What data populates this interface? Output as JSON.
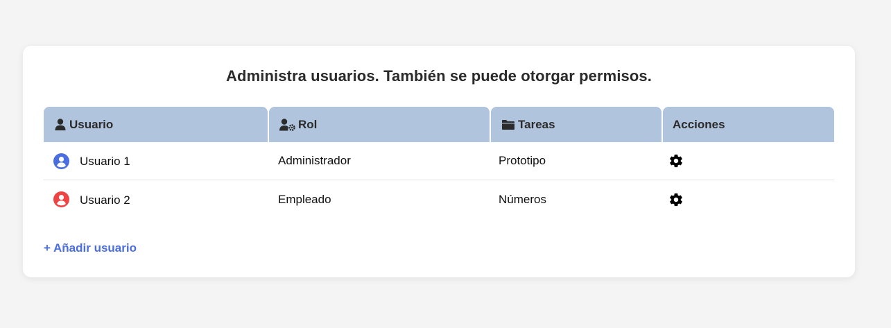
{
  "page": {
    "title": "Administra usuarios. También se puede otorgar permisos."
  },
  "table": {
    "headers": [
      {
        "label": "Usuario",
        "icon": "user-icon"
      },
      {
        "label": "Rol",
        "icon": "user-gear-icon"
      },
      {
        "label": "Tareas",
        "icon": "folder-icon"
      },
      {
        "label": "Acciones",
        "icon": ""
      }
    ],
    "rows": [
      {
        "user": "Usuario 1",
        "avatar_color": "#4a6ee0",
        "role": "Administrador",
        "tasks": "Prototipo",
        "action_icon": "gear-icon"
      },
      {
        "user": "Usuario 2",
        "avatar_color": "#ef4444",
        "role": "Empleado",
        "tasks": "Números",
        "action_icon": "gear-icon"
      }
    ]
  },
  "add_user": {
    "label": "+ Añadir usuario",
    "color": "#4a6ee0"
  },
  "colors": {
    "header_bg": "#b0c4de",
    "page_bg": "#f4f4f4",
    "card_bg": "#ffffff"
  }
}
